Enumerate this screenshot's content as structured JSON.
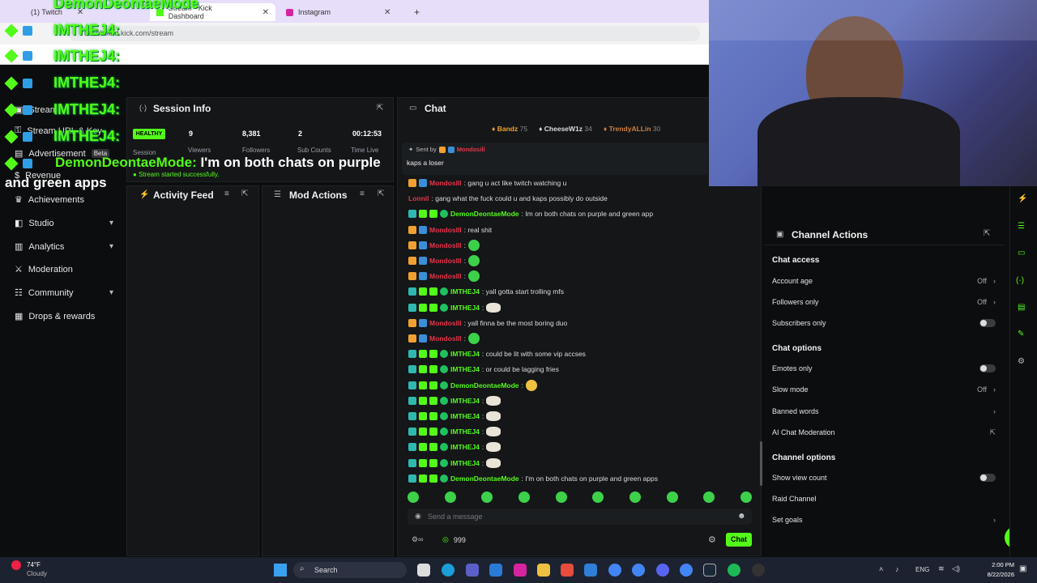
{
  "browser": {
    "tabs": [
      {
        "label": "(1) Twitch"
      },
      {
        "label": "Stream - Kick Dashboard"
      },
      {
        "label": "Instagram"
      }
    ],
    "new_tab": "+",
    "url": "dashboard.kick.com/stream"
  },
  "overlay": {
    "username": "IMTHEJ4:",
    "top_name": "DemonDeontaeMode",
    "message_name": "DemonDeontaeMode:",
    "message_text": "I'm on both chats on purple",
    "message_cont": "and green apps"
  },
  "sidebar": {
    "items": [
      {
        "label": "Stream"
      },
      {
        "label": "Stream URL & Key"
      },
      {
        "label": "Advertisement",
        "tag": "Beta"
      },
      {
        "label": "Revenue"
      },
      {
        "label": "Achievements"
      },
      {
        "label": "Studio",
        "chev": "▾"
      },
      {
        "label": "Analytics",
        "chev": "▾"
      },
      {
        "label": "Moderation"
      },
      {
        "label": "Community",
        "chev": "▾"
      },
      {
        "label": "Drops & rewards"
      }
    ]
  },
  "session": {
    "title": "Session Info",
    "health": "HEALTHY",
    "health_label": "Session",
    "viewers": "9",
    "viewers_label": "Viewers",
    "followers": "8,381",
    "followers_label": "Followers",
    "subs": "2",
    "subs_label": "Sub Counts",
    "time": "00:12:53",
    "time_label": "Time Live",
    "status": "Stream started successfully."
  },
  "activity": {
    "title": "Activity Feed"
  },
  "mod": {
    "title": "Mod Actions"
  },
  "chat": {
    "title": "Chat",
    "top_gifters": [
      {
        "name": "Bandz",
        "count": "75"
      },
      {
        "name": "CheeseW1z",
        "count": "34"
      },
      {
        "name": "TrendyALLin",
        "count": "30"
      }
    ],
    "pinned_sent_by": "Sent by",
    "pinned_user": "Mondosill",
    "pinned_text": "kaps a loser",
    "messages": [
      {
        "user": "MondosIll",
        "text": ": gang u act like twitch watching u",
        "color": "red"
      },
      {
        "user": "Lonnil",
        "text": ": gang what the fuck could u and kaps possibly do outside",
        "color": "red"
      },
      {
        "user": "DemonDeontaeMode",
        "text": ": Im on both chats on purple and green app",
        "color": "green"
      },
      {
        "user": "MondosIll",
        "text": ": real shit",
        "color": "red"
      },
      {
        "user": "MondosIll",
        "text": ":",
        "color": "red",
        "emote": "green"
      },
      {
        "user": "MondosIll",
        "text": ":",
        "color": "red",
        "emote": "green"
      },
      {
        "user": "MondosIll",
        "text": ":",
        "color": "red",
        "emote": "green"
      },
      {
        "user": "IMTHEJ4",
        "text": ": yall gotta start trolling mfs",
        "color": "green"
      },
      {
        "user": "IMTHEJ4",
        "text": ":",
        "color": "green",
        "emote": "white"
      },
      {
        "user": "MondosIll",
        "text": ": yall finna be the most boring duo",
        "color": "red"
      },
      {
        "user": "MondosIll",
        "text": ":",
        "color": "red",
        "emote": "green"
      },
      {
        "user": "IMTHEJ4",
        "text": ": could be lit with some vip accses",
        "color": "green"
      },
      {
        "user": "IMTHEJ4",
        "text": ": or could be lagging fries",
        "color": "green"
      },
      {
        "user": "DemonDeontaeMode",
        "text": ":",
        "color": "green",
        "emote": "yellow"
      },
      {
        "user": "IMTHEJ4",
        "text": ":",
        "color": "green",
        "emote": "white"
      },
      {
        "user": "IMTHEJ4",
        "text": ":",
        "color": "green",
        "emote": "white"
      },
      {
        "user": "IMTHEJ4",
        "text": ":",
        "color": "green",
        "emote": "white"
      },
      {
        "user": "IMTHEJ4",
        "text": ":",
        "color": "green",
        "emote": "white"
      },
      {
        "user": "IMTHEJ4",
        "text": ":",
        "color": "green",
        "emote": "white"
      },
      {
        "user": "DemonDeontaeMode",
        "text": ": I'm on both chats on purple and green apps",
        "color": "green"
      }
    ],
    "input_placeholder": "Send a message",
    "points": "999",
    "send_label": "Chat"
  },
  "channel_actions": {
    "title": "Channel Actions",
    "chat_access": "Chat access",
    "account_age": "Account age",
    "account_age_val": "Off",
    "followers_only": "Followers only",
    "followers_only_val": "Off",
    "subscribers_only": "Subscribers only",
    "chat_options": "Chat options",
    "emotes_only": "Emotes only",
    "slow_mode": "Slow mode",
    "slow_mode_val": "Off",
    "banned_words": "Banned words",
    "ai_moderation": "AI Chat Moderation",
    "channel_options": "Channel options",
    "show_view_count": "Show view count",
    "raid_channel": "Raid Channel",
    "set_goals": "Set goals"
  },
  "taskbar": {
    "weather_temp": "74°F",
    "weather_desc": "Cloudy",
    "search": "Search",
    "lang": "ENG",
    "time": "2:00 PM",
    "date": "8/22/2026"
  },
  "colors": {
    "accent": "#53fc18",
    "bg": "#0b0d0e",
    "panel": "#141618"
  }
}
